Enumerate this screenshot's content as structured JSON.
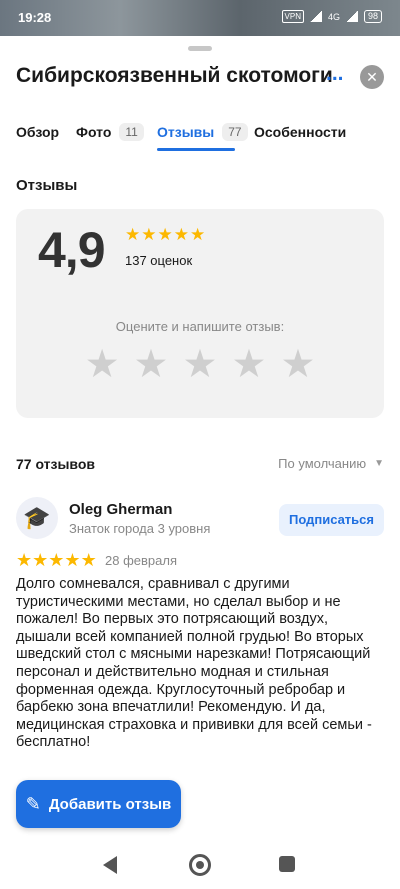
{
  "status_bar": {
    "time": "19:28",
    "vpn": "VPN",
    "network": "4G",
    "battery": "98"
  },
  "sheet": {
    "title": "Сибирскоязвенный скотомогильн",
    "title_more": "...",
    "close_icon": "close-icon"
  },
  "tabs": [
    {
      "label": "Обзор",
      "badge": ""
    },
    {
      "label": "Фото",
      "badge": "11"
    },
    {
      "label": "Отзывы",
      "badge": "77",
      "active": true
    },
    {
      "label": "Особенности",
      "badge": ""
    }
  ],
  "reviews_section": {
    "title": "Отзывы",
    "rating": "4,9",
    "rating_value": 4.9,
    "ratings_count_label": "137 оценок",
    "rate_prompt": "Оцените и напишите отзыв:",
    "filled_stars": 5,
    "empty_rate_stars": 5
  },
  "reviews_list": {
    "count_label": "77 отзывов",
    "sort_label": "По умолчанию"
  },
  "review": {
    "author": "Oleg Gherman",
    "level": "Знаток города 3 уровня",
    "subscribe_label": "Подписаться",
    "stars": 5,
    "date": "28 февраля",
    "text": "Долго сомневался, сравнивал с другими туристическими местами, но сделал выбор и не пожалел! Во первых это потрясающий воздух, дышали всей компанией полной грудью! Во вторых шведский стол с мясными нарезками! Потрясающий персонал и действительно модная и стильная форменная одежда. Круглосуточный ребробар и барбекю зона впечатлили! Рекомендую. И да, медицинская страховка и прививки для всей семьи - бесплатно!"
  },
  "add_review": {
    "label": "Добавить отзыв",
    "icon": "pencil-icon"
  },
  "colors": {
    "accent": "#1f6fe0",
    "star": "#fcb800",
    "card_bg": "#f2f2f2"
  }
}
